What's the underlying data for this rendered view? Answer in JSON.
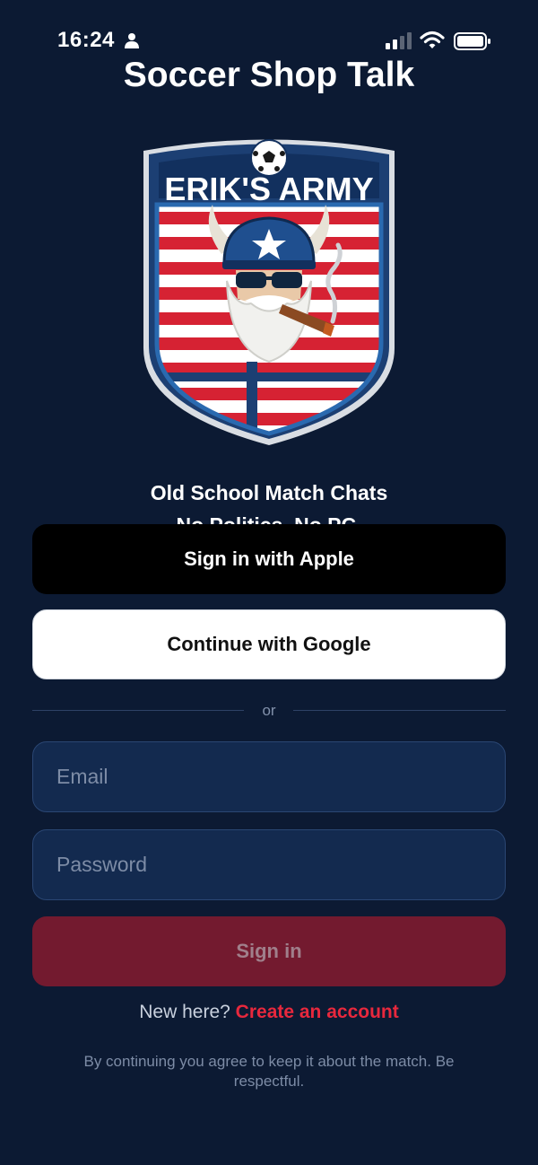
{
  "status_bar": {
    "time": "16:24",
    "icons": [
      "person-icon",
      "signal-icon",
      "wifi-icon",
      "battery-icon"
    ]
  },
  "app": {
    "title": "Soccer Shop Talk"
  },
  "crest": {
    "text": "ERIK'S ARMY"
  },
  "tagline": {
    "line1": "Old School Match Chats",
    "line2": "No Politics. No PC."
  },
  "auth": {
    "apple_label": "Sign in with Apple",
    "google_label": "Continue with Google",
    "divider": "or",
    "email_placeholder": "Email",
    "password_placeholder": "Password",
    "signin_label": "Sign in",
    "signup_prompt": "New here?",
    "signup_link": "Create an account",
    "legal": "By continuing you agree to keep it about the match. Be respectful."
  },
  "colors": {
    "background": "#0c1a33",
    "accent_red": "#e8283d",
    "signin_disabled": "#731a2f",
    "field_bg": "#132a4f"
  }
}
